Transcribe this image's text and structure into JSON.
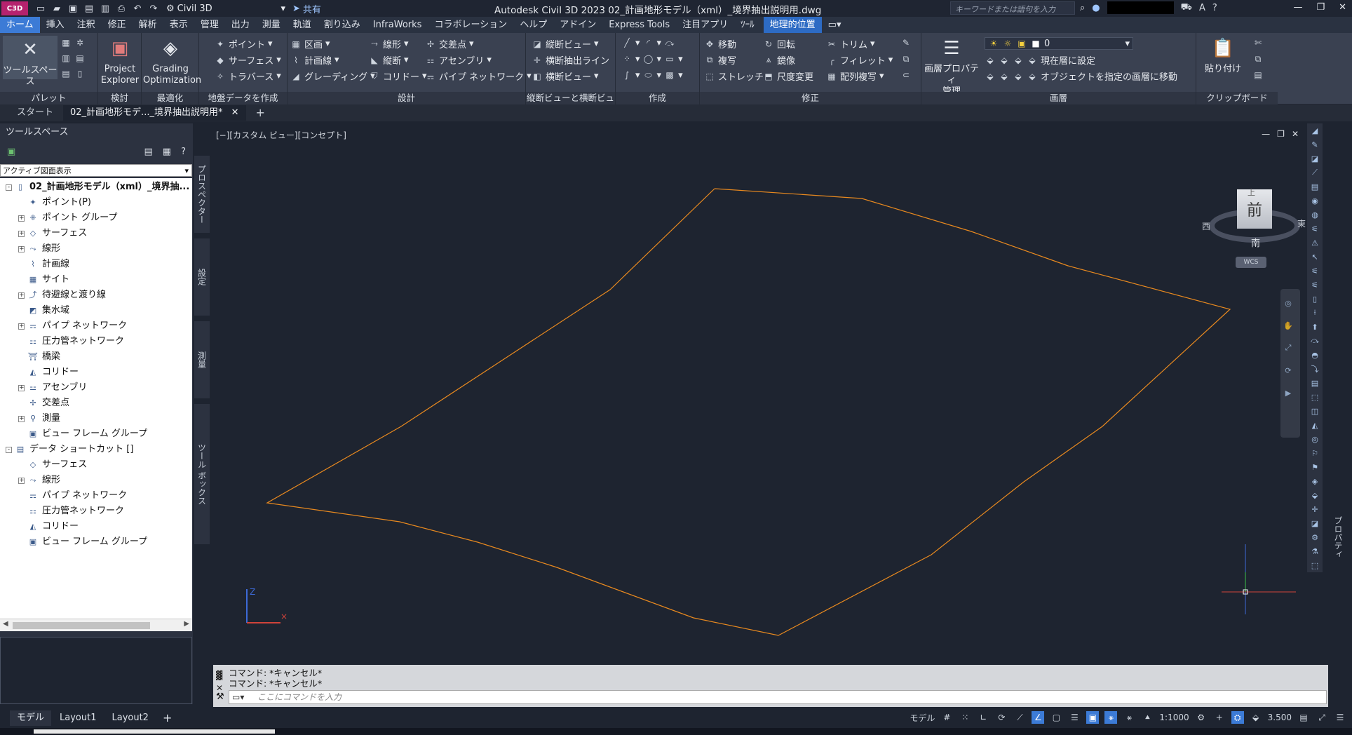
{
  "titlebar": {
    "logo": "C3D",
    "workspace": "Civil 3D",
    "share": "共有",
    "title": "Autodesk Civil 3D 2023   02_計画地形モデル（xml）_境界抽出説明用.dwg",
    "search_placeholder": "キーワードまたは語句を入力"
  },
  "ribbon_tabs": [
    "ホーム",
    "挿入",
    "注釈",
    "修正",
    "解析",
    "表示",
    "管理",
    "出力",
    "測量",
    "軌道",
    "割り込み",
    "InfraWorks",
    "コラボレーション",
    "ヘルプ",
    "アドイン",
    "Express Tools",
    "注目アプリ",
    "ﾂｰﾙ",
    "地理的位置"
  ],
  "ribbon": {
    "palette": {
      "title": "パレット",
      "big": "ツールスペース"
    },
    "explore": {
      "title": "検討",
      "big1": "Project",
      "big2": "Explorer"
    },
    "optimize": {
      "title": "最適化",
      "big1": "Grading",
      "big2": "Optimization"
    },
    "ground": {
      "title": "地盤データを作成",
      "b1": "ポイント",
      "b2": "サーフェス",
      "b3": "トラバース"
    },
    "design": {
      "title": "設計",
      "b1": "区画",
      "b2": "計画線",
      "b3": "グレーディング",
      "b4": "線形",
      "b5": "縦断",
      "b6": "コリドー",
      "b7": "交差点",
      "b8": "アセンブリ",
      "b9": "パイプ ネットワーク"
    },
    "profile": {
      "title": "縦断ビューと横断ビュー",
      "b1": "縦断ビュー",
      "b2": "横断抽出ライン",
      "b3": "横断ビュー"
    },
    "draw": {
      "title": "作成"
    },
    "modify": {
      "title": "修正",
      "b1": "移動",
      "b2": "回転",
      "b3": "トリム",
      "b4": "複写",
      "b5": "鏡像",
      "b6": "フィレット",
      "b7": "ストレッチ",
      "b8": "尺度変更",
      "b9": "配列複写"
    },
    "layers": {
      "title": "画層",
      "big1": "画層プロパティ",
      "big2": "管理",
      "layer_value": "0",
      "b1": "現在層に設定",
      "b2": "オブジェクトを指定の画層に移動"
    },
    "clipboard": {
      "title": "クリップボード",
      "big": "貼り付け"
    }
  },
  "doc_tabs": {
    "start": "スタート",
    "current": "02_計画地形モデ..._境界抽出説明用*"
  },
  "toolspace": {
    "title": "ツールスペース",
    "view_select": "アクティブ図面表示",
    "tree": [
      {
        "label": "02_計画地形モデル（xml）_境界抽...",
        "level": 0,
        "exp": "-",
        "bold": true,
        "icon": "doc-icon"
      },
      {
        "label": "ポイント(P)",
        "level": 1,
        "exp": "",
        "icon": "point-icon"
      },
      {
        "label": "ポイント グループ",
        "level": 1,
        "exp": "+",
        "icon": "point-group-icon"
      },
      {
        "label": "サーフェス",
        "level": 1,
        "exp": "+",
        "icon": "surface-icon"
      },
      {
        "label": "線形",
        "level": 1,
        "exp": "+",
        "icon": "alignment-icon"
      },
      {
        "label": "計画線",
        "level": 1,
        "exp": "",
        "icon": "feature-line-icon"
      },
      {
        "label": "サイト",
        "level": 1,
        "exp": "",
        "icon": "site-icon"
      },
      {
        "label": "待避線と渡り線",
        "level": 1,
        "exp": "+",
        "icon": "siding-icon"
      },
      {
        "label": "集水域",
        "level": 1,
        "exp": "",
        "icon": "catchment-icon"
      },
      {
        "label": "パイプ ネットワーク",
        "level": 1,
        "exp": "+",
        "icon": "pipe-network-icon"
      },
      {
        "label": "圧力管ネットワーク",
        "level": 1,
        "exp": "",
        "icon": "pressure-network-icon"
      },
      {
        "label": "橋梁",
        "level": 1,
        "exp": "",
        "icon": "bridge-icon"
      },
      {
        "label": "コリドー",
        "level": 1,
        "exp": "",
        "icon": "corridor-icon"
      },
      {
        "label": "アセンブリ",
        "level": 1,
        "exp": "+",
        "icon": "assembly-icon"
      },
      {
        "label": "交差点",
        "level": 1,
        "exp": "",
        "icon": "intersection-icon"
      },
      {
        "label": "測量",
        "level": 1,
        "exp": "+",
        "icon": "survey-icon"
      },
      {
        "label": "ビュー フレーム グループ",
        "level": 1,
        "exp": "",
        "icon": "view-frame-icon"
      },
      {
        "label": "データ ショートカット []",
        "level": 0,
        "exp": "-",
        "bold": false,
        "icon": "shortcut-icon"
      },
      {
        "label": "サーフェス",
        "level": 1,
        "exp": "",
        "icon": "surface-icon"
      },
      {
        "label": "線形",
        "level": 1,
        "exp": "+",
        "icon": "alignment-icon"
      },
      {
        "label": "パイプ ネットワーク",
        "level": 1,
        "exp": "",
        "icon": "pipe-network-icon"
      },
      {
        "label": "圧力管ネットワーク",
        "level": 1,
        "exp": "",
        "icon": "pressure-network-icon"
      },
      {
        "label": "コリドー",
        "level": 1,
        "exp": "",
        "icon": "corridor-icon"
      },
      {
        "label": "ビュー フレーム グループ",
        "level": 1,
        "exp": "",
        "icon": "view-frame-icon"
      }
    ],
    "side_tabs": [
      "プロスペクター",
      "設定",
      "測量",
      "ツール ボックス"
    ]
  },
  "viewport": {
    "label": "[−][カスタム ビュー][コンセプト]",
    "viewcube": {
      "face": "前",
      "top": "上",
      "west": "西",
      "east": "東",
      "south": "南",
      "wcs": "WCS"
    },
    "boundary_color": "#e8891f"
  },
  "properties_label": "プロパティ",
  "command": {
    "history": [
      "コマンド:  *キャンセル*",
      "コマンド:  *キャンセル*"
    ],
    "placeholder": "ここにコマンドを入力"
  },
  "status": {
    "tabs": [
      "モデル",
      "Layout1",
      "Layout2"
    ],
    "model": "モデル",
    "scale": "1:1000",
    "value": "3.500"
  }
}
